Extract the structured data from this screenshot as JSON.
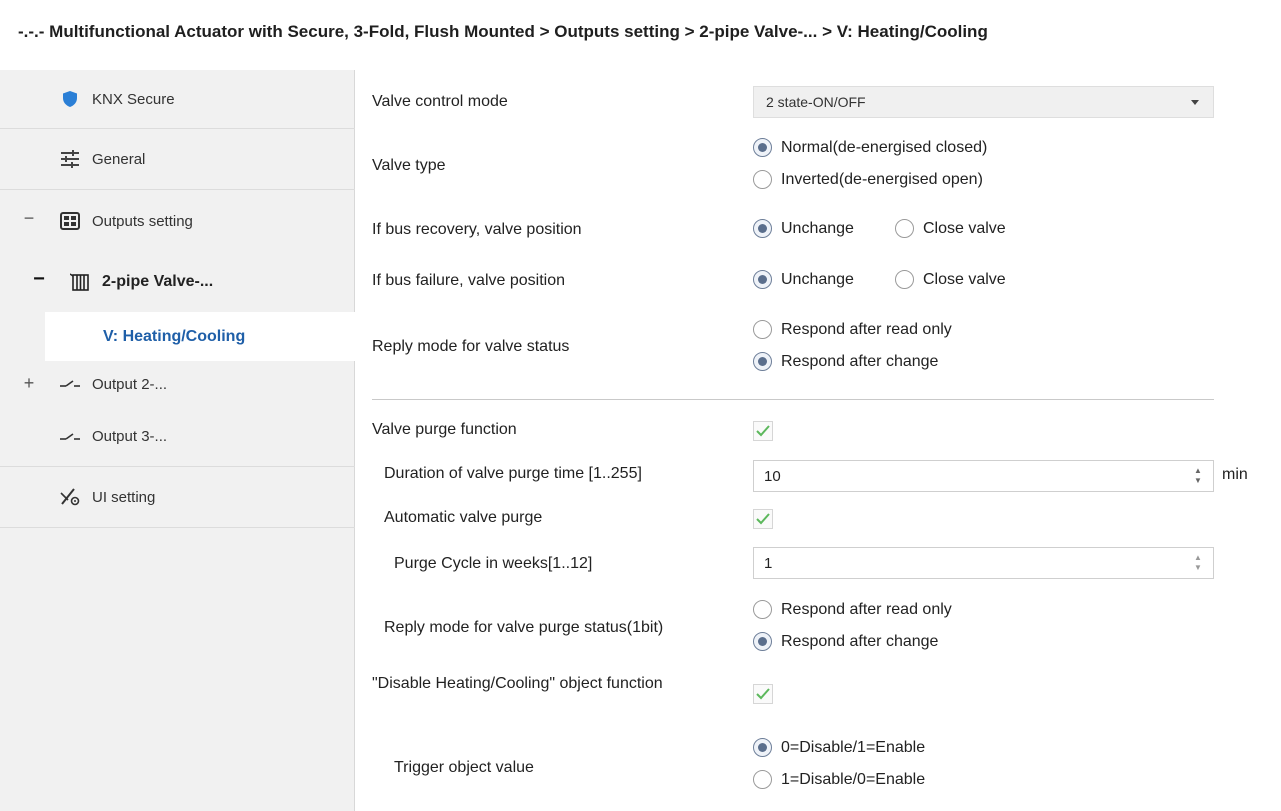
{
  "breadcrumb": "-.-.- Multifunctional Actuator with Secure, 3-Fold, Flush Mounted > Outputs setting > 2-pipe Valve-... > V: Heating/Cooling",
  "sidebar": {
    "items": [
      {
        "label": "KNX Secure",
        "icon": "shield-icon"
      },
      {
        "label": "General",
        "icon": "sliders-icon"
      },
      {
        "label": "Outputs setting",
        "icon": "grid-icon",
        "expander": "−"
      },
      {
        "label": "2-pipe Valve-...",
        "icon": "radiator-icon",
        "expander": "−"
      },
      {
        "label": "V: Heating/Cooling"
      },
      {
        "label": "Output 2-...",
        "icon": "switch-icon",
        "expander": "+"
      },
      {
        "label": "Output 3-...",
        "icon": "switch-icon"
      },
      {
        "label": "UI setting",
        "icon": "ui-setting-icon"
      }
    ]
  },
  "form": {
    "valve_control_mode": {
      "label": "Valve control mode",
      "value": "2 state-ON/OFF"
    },
    "valve_type": {
      "label": "Valve type",
      "options": [
        "Normal(de-energised closed)",
        "Inverted(de-energised open)"
      ],
      "selected": 0
    },
    "bus_recovery": {
      "label": "If bus recovery, valve position",
      "options": [
        "Unchange",
        "Close valve"
      ],
      "selected": 0
    },
    "bus_failure": {
      "label": "If bus failure, valve position",
      "options": [
        "Unchange",
        "Close valve"
      ],
      "selected": 0
    },
    "reply_valve_status": {
      "label": "Reply mode for valve status",
      "options": [
        "Respond after read only",
        "Respond after change"
      ],
      "selected": 1
    },
    "valve_purge_function": {
      "label": "Valve purge function",
      "checked": true
    },
    "purge_duration": {
      "label": "Duration of valve purge time [1..255]",
      "value": "10",
      "unit": "min"
    },
    "automatic_purge": {
      "label": "Automatic valve purge",
      "checked": true
    },
    "purge_cycle": {
      "label": "Purge Cycle in weeks[1..12]",
      "value": "1"
    },
    "reply_purge_status": {
      "label": "Reply mode for valve purge status(1bit)",
      "options": [
        "Respond after read only",
        "Respond after change"
      ],
      "selected": 1
    },
    "disable_hc": {
      "label": "\"Disable Heating/Cooling\" object function",
      "checked": true
    },
    "trigger_value": {
      "label": "Trigger object value",
      "options": [
        "0=Disable/1=Enable",
        "1=Disable/0=Enable"
      ],
      "selected": 0
    }
  },
  "colors": {
    "accent": "#1f5fa8",
    "check": "#5cb85c",
    "sidebar_bg": "#f1f1f1"
  }
}
